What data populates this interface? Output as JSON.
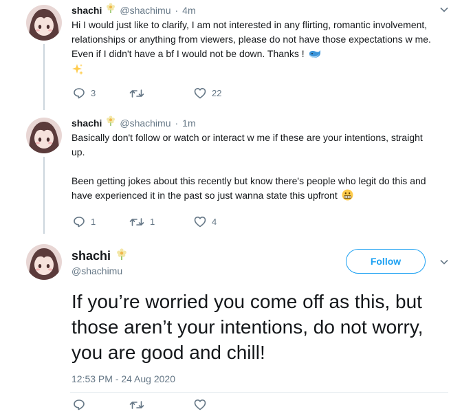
{
  "tweet1": {
    "name": "shachi",
    "handle": "@shachimu",
    "separator": "·",
    "time": "4m",
    "text": "Hi I would just like to clarify, I am not interested in any flirting, romantic involvement, relationships or anything from viewers, please do not have those expectations w me. Even if I didn't have a bf I would not be down. Thanks !",
    "emoji_trailing": [
      "whale-emoji",
      "sparkles-emoji"
    ],
    "replies": "3",
    "retweets": "",
    "likes": "22"
  },
  "tweet2": {
    "name": "shachi",
    "handle": "@shachimu",
    "separator": "·",
    "time": "1m",
    "text_line1": "Basically don't follow or watch or interact w me if these are your intentions, straight up.",
    "text_line2": "Been getting jokes about this recently but know there's people who legit do this and have experienced it in the past so just wanna state this upfront",
    "emoji_trailing": [
      "grimacing-face-emoji"
    ],
    "replies": "1",
    "retweets": "1",
    "likes": "4"
  },
  "tweet3": {
    "name": "shachi",
    "handle": "@shachimu",
    "follow_label": "Follow",
    "text": "If you’re worried you come off as this, but those aren’t your intentions, do not worry, you are good and chill!",
    "timestamp": "12:53 PM - 24 Aug 2020"
  },
  "colors": {
    "accent": "#1da1f2",
    "muted": "#657786",
    "text": "#14171a",
    "thread_line": "#ccd6dd"
  },
  "icons": {
    "name_badge": "flower-icon",
    "reply": "reply-icon",
    "retweet": "retweet-icon",
    "like": "heart-icon",
    "more": "chevron-down-icon"
  }
}
